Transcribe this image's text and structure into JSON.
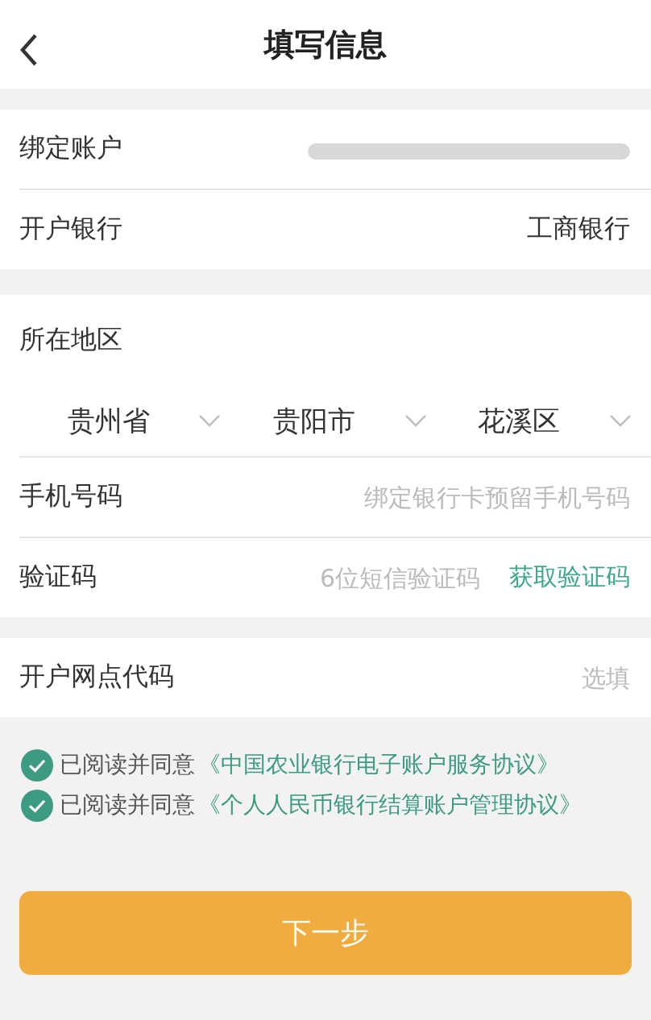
{
  "header": {
    "title": "填写信息"
  },
  "account_section": [
    {
      "label": "绑定账户",
      "kind": "masked"
    },
    {
      "label": "开户银行",
      "value": "工商银行",
      "kind": "text"
    }
  ],
  "region": {
    "label": "所在地区",
    "selects": [
      {
        "value": "贵州省"
      },
      {
        "value": "贵阳市"
      },
      {
        "value": "花溪区"
      }
    ]
  },
  "phone": {
    "label": "手机号码",
    "placeholder": "绑定银行卡预留手机号码"
  },
  "verification": {
    "label": "验证码",
    "placeholder": "6位短信验证码",
    "action": "获取验证码"
  },
  "branch": {
    "label": "开户网点代码",
    "placeholder": "选填"
  },
  "agreements": [
    {
      "checked": true,
      "text": "已阅读并同意",
      "link": "《中国农业银行电子账户服务协议》"
    },
    {
      "checked": true,
      "text": "已阅读并同意",
      "link": "《个人人民币银行结算账户管理协议》"
    }
  ],
  "next_button": "下一步"
}
